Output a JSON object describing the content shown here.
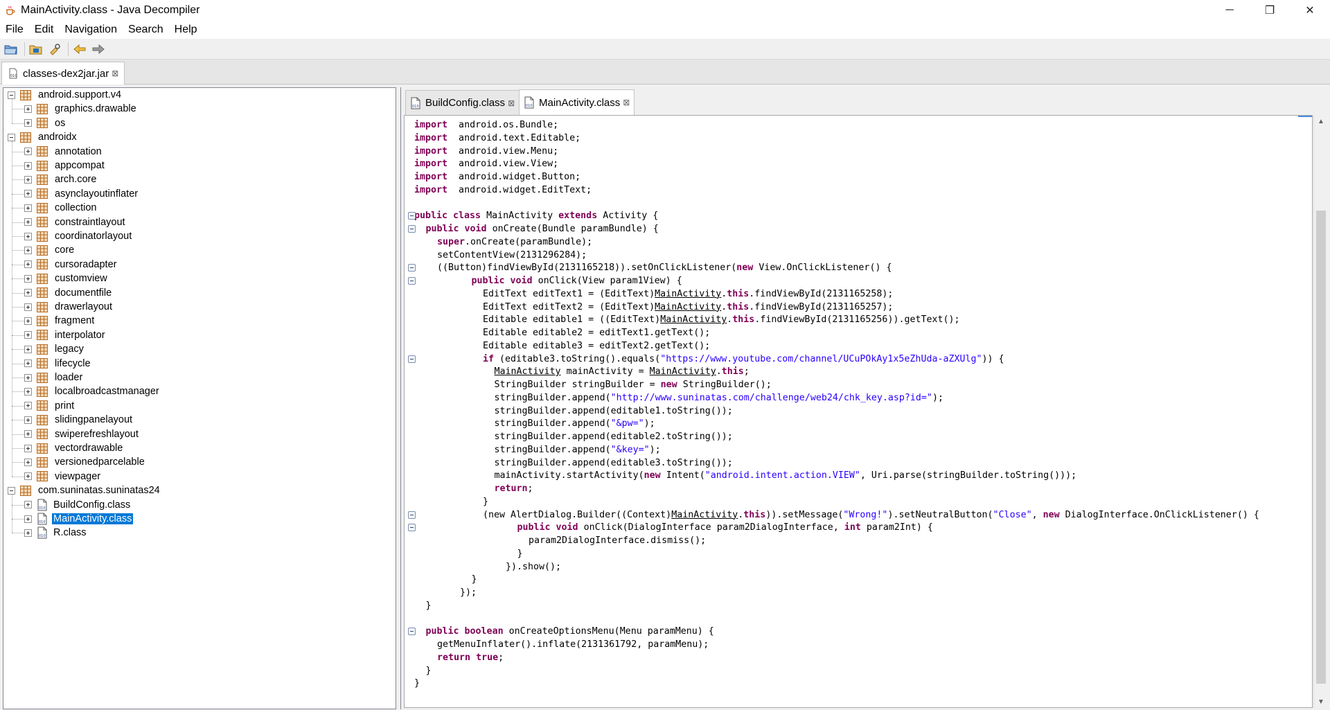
{
  "window": {
    "title": "MainActivity.class - Java Decompiler",
    "minimize": "─",
    "maximize": "❐",
    "close": "✕"
  },
  "menu": [
    "File",
    "Edit",
    "Navigation",
    "Search",
    "Help"
  ],
  "toolbar": {
    "icons": [
      "open-file-icon",
      "open-type-icon",
      "search-type-icon",
      "back-icon",
      "forward-icon"
    ]
  },
  "jar_tab": {
    "label": "classes-dex2jar.jar"
  },
  "tree": [
    {
      "label": "android.support.v4",
      "kind": "package",
      "level": 0,
      "expanded": true
    },
    {
      "label": "graphics.drawable",
      "kind": "package",
      "level": 1,
      "expanded": false
    },
    {
      "label": "os",
      "kind": "package",
      "level": 1,
      "expanded": false
    },
    {
      "label": "androidx",
      "kind": "package",
      "level": 0,
      "expanded": true
    },
    {
      "label": "annotation",
      "kind": "package",
      "level": 1,
      "expanded": false
    },
    {
      "label": "appcompat",
      "kind": "package",
      "level": 1,
      "expanded": false
    },
    {
      "label": "arch.core",
      "kind": "package",
      "level": 1,
      "expanded": false
    },
    {
      "label": "asynclayoutinflater",
      "kind": "package",
      "level": 1,
      "expanded": false
    },
    {
      "label": "collection",
      "kind": "package",
      "level": 1,
      "expanded": false
    },
    {
      "label": "constraintlayout",
      "kind": "package",
      "level": 1,
      "expanded": false
    },
    {
      "label": "coordinatorlayout",
      "kind": "package",
      "level": 1,
      "expanded": false
    },
    {
      "label": "core",
      "kind": "package",
      "level": 1,
      "expanded": false
    },
    {
      "label": "cursoradapter",
      "kind": "package",
      "level": 1,
      "expanded": false
    },
    {
      "label": "customview",
      "kind": "package",
      "level": 1,
      "expanded": false
    },
    {
      "label": "documentfile",
      "kind": "package",
      "level": 1,
      "expanded": false
    },
    {
      "label": "drawerlayout",
      "kind": "package",
      "level": 1,
      "expanded": false
    },
    {
      "label": "fragment",
      "kind": "package",
      "level": 1,
      "expanded": false
    },
    {
      "label": "interpolator",
      "kind": "package",
      "level": 1,
      "expanded": false
    },
    {
      "label": "legacy",
      "kind": "package",
      "level": 1,
      "expanded": false
    },
    {
      "label": "lifecycle",
      "kind": "package",
      "level": 1,
      "expanded": false
    },
    {
      "label": "loader",
      "kind": "package",
      "level": 1,
      "expanded": false
    },
    {
      "label": "localbroadcastmanager",
      "kind": "package",
      "level": 1,
      "expanded": false
    },
    {
      "label": "print",
      "kind": "package",
      "level": 1,
      "expanded": false
    },
    {
      "label": "slidingpanelayout",
      "kind": "package",
      "level": 1,
      "expanded": false
    },
    {
      "label": "swiperefreshlayout",
      "kind": "package",
      "level": 1,
      "expanded": false
    },
    {
      "label": "vectordrawable",
      "kind": "package",
      "level": 1,
      "expanded": false
    },
    {
      "label": "versionedparcelable",
      "kind": "package",
      "level": 1,
      "expanded": false
    },
    {
      "label": "viewpager",
      "kind": "package",
      "level": 1,
      "expanded": false
    },
    {
      "label": "com.suninatas.suninatas24",
      "kind": "package",
      "level": 0,
      "expanded": true
    },
    {
      "label": "BuildConfig.class",
      "kind": "class",
      "level": 1,
      "expanded": false
    },
    {
      "label": "MainActivity.class",
      "kind": "class",
      "level": 1,
      "expanded": false,
      "selected": true
    },
    {
      "label": "R.class",
      "kind": "class",
      "level": 1,
      "expanded": false
    }
  ],
  "editor_tabs": [
    {
      "label": "BuildConfig.class",
      "active": false
    },
    {
      "label": "MainActivity.class",
      "active": true
    }
  ],
  "code": [
    {
      "indent": 0,
      "fold": false,
      "segs": [
        [
          "kw",
          "import"
        ],
        [
          "",
          "  android.os.Bundle;"
        ]
      ]
    },
    {
      "indent": 0,
      "fold": false,
      "segs": [
        [
          "kw",
          "import"
        ],
        [
          "",
          "  android.text.Editable;"
        ]
      ]
    },
    {
      "indent": 0,
      "fold": false,
      "segs": [
        [
          "kw",
          "import"
        ],
        [
          "",
          "  android.view.Menu;"
        ]
      ]
    },
    {
      "indent": 0,
      "fold": false,
      "segs": [
        [
          "kw",
          "import"
        ],
        [
          "",
          "  android.view.View;"
        ]
      ]
    },
    {
      "indent": 0,
      "fold": false,
      "segs": [
        [
          "kw",
          "import"
        ],
        [
          "",
          "  android.widget.Button;"
        ]
      ]
    },
    {
      "indent": 0,
      "fold": false,
      "segs": [
        [
          "kw",
          "import"
        ],
        [
          "",
          "  android.widget.EditText;"
        ]
      ]
    },
    {
      "indent": 0,
      "fold": false,
      "segs": []
    },
    {
      "indent": 0,
      "fold": true,
      "segs": [
        [
          "kw",
          "public class"
        ],
        [
          "",
          " MainActivity "
        ],
        [
          "kw",
          "extends"
        ],
        [
          "",
          " Activity {"
        ]
      ]
    },
    {
      "indent": 1,
      "fold": true,
      "segs": [
        [
          "kw",
          "public void"
        ],
        [
          "",
          " onCreate(Bundle paramBundle) {"
        ]
      ]
    },
    {
      "indent": 2,
      "fold": false,
      "segs": [
        [
          "kw",
          "super"
        ],
        [
          "",
          ".onCreate(paramBundle);"
        ]
      ]
    },
    {
      "indent": 2,
      "fold": false,
      "segs": [
        [
          "",
          "setContentView(2131296284);"
        ]
      ]
    },
    {
      "indent": 2,
      "fold": true,
      "segs": [
        [
          "",
          "((Button)findViewById(2131165218)).setOnClickListener("
        ],
        [
          "kw",
          "new"
        ],
        [
          "",
          " View.OnClickListener() {"
        ]
      ]
    },
    {
      "indent": 5,
      "fold": true,
      "segs": [
        [
          "kw",
          "public void"
        ],
        [
          "",
          " onClick(View param1View) {"
        ]
      ]
    },
    {
      "indent": 6,
      "fold": false,
      "segs": [
        [
          "",
          "EditText editText1 = (EditText)"
        ],
        [
          "ul",
          "MainActivity"
        ],
        [
          "",
          "."
        ],
        [
          "kw",
          "this"
        ],
        [
          "",
          ".findViewById(2131165258);"
        ]
      ]
    },
    {
      "indent": 6,
      "fold": false,
      "segs": [
        [
          "",
          "EditText editText2 = (EditText)"
        ],
        [
          "ul",
          "MainActivity"
        ],
        [
          "",
          "."
        ],
        [
          "kw",
          "this"
        ],
        [
          "",
          ".findViewById(2131165257);"
        ]
      ]
    },
    {
      "indent": 6,
      "fold": false,
      "segs": [
        [
          "",
          "Editable editable1 = ((EditText)"
        ],
        [
          "ul",
          "MainActivity"
        ],
        [
          "",
          "."
        ],
        [
          "kw",
          "this"
        ],
        [
          "",
          ".findViewById(2131165256)).getText();"
        ]
      ]
    },
    {
      "indent": 6,
      "fold": false,
      "segs": [
        [
          "",
          "Editable editable2 = editText1.getText();"
        ]
      ]
    },
    {
      "indent": 6,
      "fold": false,
      "segs": [
        [
          "",
          "Editable editable3 = editText2.getText();"
        ]
      ]
    },
    {
      "indent": 6,
      "fold": true,
      "segs": [
        [
          "kw",
          "if"
        ],
        [
          "",
          " (editable3.toString().equals("
        ],
        [
          "str",
          "\"https://www.youtube.com/channel/UCuPOkAy1x5eZhUda-aZXUlg\""
        ],
        [
          "",
          ")) {"
        ]
      ]
    },
    {
      "indent": 7,
      "fold": false,
      "segs": [
        [
          "ul",
          "MainActivity"
        ],
        [
          "",
          " mainActivity = "
        ],
        [
          "ul",
          "MainActivity"
        ],
        [
          "",
          "."
        ],
        [
          "kw",
          "this"
        ],
        [
          "",
          ";"
        ]
      ]
    },
    {
      "indent": 7,
      "fold": false,
      "segs": [
        [
          "",
          "StringBuilder stringBuilder = "
        ],
        [
          "kw",
          "new"
        ],
        [
          "",
          " StringBuilder();"
        ]
      ]
    },
    {
      "indent": 7,
      "fold": false,
      "segs": [
        [
          "",
          "stringBuilder.append("
        ],
        [
          "str",
          "\"http://www.suninatas.com/challenge/web24/chk_key.asp?id=\""
        ],
        [
          "",
          ");"
        ]
      ]
    },
    {
      "indent": 7,
      "fold": false,
      "segs": [
        [
          "",
          "stringBuilder.append(editable1.toString());"
        ]
      ]
    },
    {
      "indent": 7,
      "fold": false,
      "segs": [
        [
          "",
          "stringBuilder.append("
        ],
        [
          "str",
          "\"&pw=\""
        ],
        [
          "",
          ");"
        ]
      ]
    },
    {
      "indent": 7,
      "fold": false,
      "segs": [
        [
          "",
          "stringBuilder.append(editable2.toString());"
        ]
      ]
    },
    {
      "indent": 7,
      "fold": false,
      "segs": [
        [
          "",
          "stringBuilder.append("
        ],
        [
          "str",
          "\"&key=\""
        ],
        [
          "",
          ");"
        ]
      ]
    },
    {
      "indent": 7,
      "fold": false,
      "segs": [
        [
          "",
          "stringBuilder.append(editable3.toString());"
        ]
      ]
    },
    {
      "indent": 7,
      "fold": false,
      "segs": [
        [
          "",
          "mainActivity.startActivity("
        ],
        [
          "kw",
          "new"
        ],
        [
          "",
          " Intent("
        ],
        [
          "str",
          "\"android.intent.action.VIEW\""
        ],
        [
          "",
          ", Uri.parse(stringBuilder.toString()));"
        ]
      ]
    },
    {
      "indent": 7,
      "fold": false,
      "segs": [
        [
          "kw",
          "return"
        ],
        [
          "",
          ";"
        ]
      ]
    },
    {
      "indent": 6,
      "fold": false,
      "segs": [
        [
          "",
          "}"
        ]
      ]
    },
    {
      "indent": 6,
      "fold": true,
      "segs": [
        [
          "",
          "(new AlertDialog.Builder((Context)"
        ],
        [
          "ul",
          "MainActivity"
        ],
        [
          "",
          "."
        ],
        [
          "kw",
          "this"
        ],
        [
          "",
          ")).setMessage("
        ],
        [
          "str",
          "\"Wrong!\""
        ],
        [
          "",
          ").setNeutralButton("
        ],
        [
          "str",
          "\"Close\""
        ],
        [
          "",
          ", "
        ],
        [
          "kw",
          "new"
        ],
        [
          "",
          " DialogInterface.OnClickListener() {"
        ]
      ]
    },
    {
      "indent": 9,
      "fold": true,
      "segs": [
        [
          "kw",
          "public void"
        ],
        [
          "",
          " onClick(DialogInterface param2DialogInterface, "
        ],
        [
          "kw",
          "int"
        ],
        [
          "",
          " param2Int) {"
        ]
      ]
    },
    {
      "indent": 10,
      "fold": false,
      "segs": [
        [
          "",
          "param2DialogInterface.dismiss();"
        ]
      ]
    },
    {
      "indent": 9,
      "fold": false,
      "segs": [
        [
          "",
          "}"
        ]
      ]
    },
    {
      "indent": 8,
      "fold": false,
      "segs": [
        [
          "",
          "}).show();"
        ]
      ]
    },
    {
      "indent": 5,
      "fold": false,
      "segs": [
        [
          "",
          "}"
        ]
      ]
    },
    {
      "indent": 4,
      "fold": false,
      "segs": [
        [
          "",
          "});"
        ]
      ]
    },
    {
      "indent": 1,
      "fold": false,
      "segs": [
        [
          "",
          "}"
        ]
      ]
    },
    {
      "indent": 0,
      "fold": false,
      "segs": []
    },
    {
      "indent": 1,
      "fold": true,
      "segs": [
        [
          "kw",
          "public boolean"
        ],
        [
          "",
          " onCreateOptionsMenu(Menu paramMenu) {"
        ]
      ]
    },
    {
      "indent": 2,
      "fold": false,
      "segs": [
        [
          "",
          "getMenuInflater().inflate(2131361792, paramMenu);"
        ]
      ]
    },
    {
      "indent": 2,
      "fold": false,
      "segs": [
        [
          "kw",
          "return"
        ],
        [
          "",
          " "
        ],
        [
          "kw",
          "true"
        ],
        [
          "",
          ";"
        ]
      ]
    },
    {
      "indent": 1,
      "fold": false,
      "segs": [
        [
          "",
          "}"
        ]
      ]
    },
    {
      "indent": 0,
      "fold": false,
      "segs": [
        [
          "",
          "}"
        ]
      ]
    }
  ],
  "colors": {
    "keyword": "#7f0055",
    "string": "#2a00ff",
    "selection": "#0078d7",
    "package_icon": "#c8742a"
  }
}
